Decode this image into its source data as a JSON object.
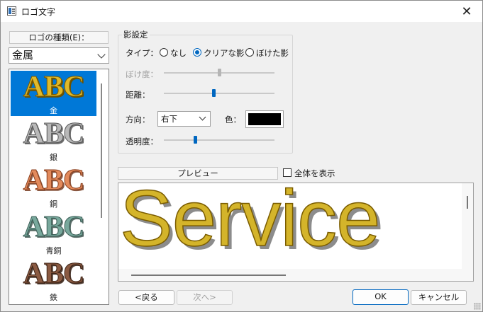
{
  "window": {
    "title": "ロゴ文字"
  },
  "left_panel": {
    "type_label": "ロゴの種類(E)：",
    "type_selected": "金属",
    "items": [
      {
        "name": "金",
        "text": "ABC",
        "color": "#e0b92a",
        "selected": true
      },
      {
        "name": "銀",
        "text": "ABC",
        "color": "#9a9a9a",
        "selected": false
      },
      {
        "name": "銅",
        "text": "ABC",
        "color": "#d9784a",
        "selected": false
      },
      {
        "name": "青銅",
        "text": "ABC",
        "color": "#6f9f94",
        "selected": false
      },
      {
        "name": "鉄",
        "text": "ABC",
        "color": "#7a4f3a",
        "selected": false
      }
    ]
  },
  "shadow": {
    "group_title": "影設定",
    "type_label": "タイプ：",
    "types": [
      {
        "label": "なし",
        "checked": false
      },
      {
        "label": "クリアな影",
        "checked": true
      },
      {
        "label": "ぼけた影",
        "checked": false
      }
    ],
    "blur_label": "ぼけ度：",
    "blur_value": 0.5,
    "blur_enabled": false,
    "distance_label": "距離：",
    "distance_value": 0.45,
    "direction_label": "方向：",
    "direction_value": "右下",
    "color_label": "色：",
    "color_value": "#000000",
    "opacity_label": "透明度：",
    "opacity_value": 0.28
  },
  "preview": {
    "label": "プレビュー",
    "show_all_label": "全体を表示",
    "show_all_checked": false,
    "text": "Service",
    "text_color": "#d4b42a"
  },
  "buttons": {
    "back": "<戻る",
    "next": "次へ>",
    "ok": "OK",
    "cancel": "キャンセル"
  }
}
